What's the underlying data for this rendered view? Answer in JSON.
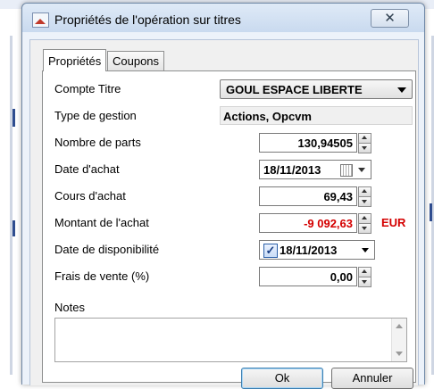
{
  "window": {
    "title": "Propriétés de l'opération sur titres",
    "close_glyph": "✕"
  },
  "tabs": [
    {
      "label": "Propriétés",
      "active": true
    },
    {
      "label": "Coupons",
      "active": false
    }
  ],
  "form": {
    "compte_titre": {
      "label": "Compte Titre",
      "value": "GOUL ESPACE LIBERTE"
    },
    "type_gestion": {
      "label": "Type de gestion",
      "value": "Actions, Opcvm"
    },
    "nombre_parts": {
      "label": "Nombre de parts",
      "value": "130,94505"
    },
    "date_achat": {
      "label": "Date d'achat",
      "value": "18/11/2013"
    },
    "cours_achat": {
      "label": "Cours d'achat",
      "value": "69,43"
    },
    "montant_achat": {
      "label": "Montant de l'achat",
      "value": "-9 092,63",
      "currency": "EUR",
      "color": "#d40000"
    },
    "date_dispo": {
      "label": "Date de disponibilité",
      "value": "18/11/2013",
      "checked": true,
      "check_glyph": "✓"
    },
    "frais_vente": {
      "label": "Frais de vente (%)",
      "value": "0,00"
    },
    "notes": {
      "label": "Notes",
      "value": ""
    }
  },
  "buttons": {
    "ok": "Ok",
    "cancel": "Annuler"
  },
  "icons": {
    "app": "chart-app-icon",
    "calendar": "calendar-icon"
  }
}
